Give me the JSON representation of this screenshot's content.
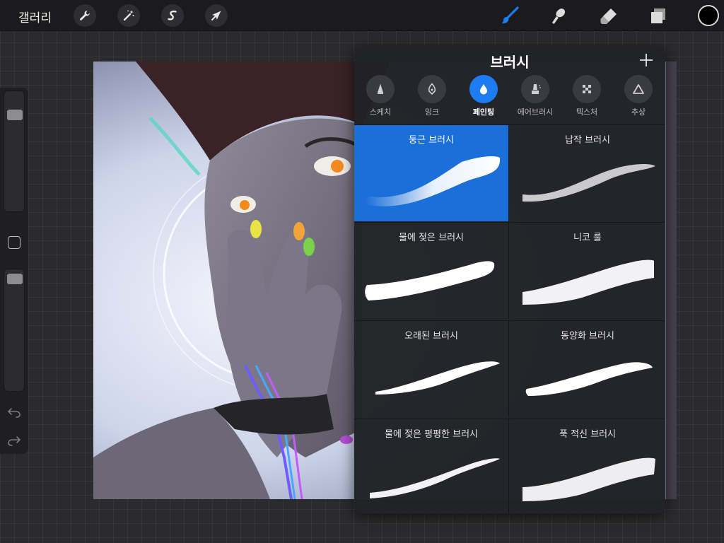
{
  "topbar": {
    "gallery_label": "갤러리",
    "actions_icon": "wrench-icon",
    "adjustments_icon": "magic-wand-icon",
    "selection_icon": "selection-s-icon",
    "transform_icon": "arrow-cursor-icon",
    "paint_icon": "brush-icon",
    "smudge_icon": "smudge-finger-icon",
    "erase_icon": "eraser-icon",
    "layers_icon": "layers-icon",
    "current_color": "#000000",
    "accent_color": "#1d7cf2"
  },
  "sidebar": {
    "brush_size_level": 0.05,
    "opacity_level": 0.05,
    "modify_icon": "square-icon",
    "undo_icon": "undo-icon",
    "redo_icon": "redo-icon"
  },
  "panel": {
    "title": "브러시",
    "add_icon": "plus-icon",
    "categories": [
      {
        "label": "스케치",
        "icon": "pencil-icon",
        "active": false
      },
      {
        "label": "잉크",
        "icon": "pen-nib-icon",
        "active": false
      },
      {
        "label": "페인팅",
        "icon": "droplet-icon",
        "active": true
      },
      {
        "label": "에어브러시",
        "icon": "airbrush-icon",
        "active": false
      },
      {
        "label": "텍스처",
        "icon": "texture-icon",
        "active": false
      },
      {
        "label": "추상",
        "icon": "triangle-icon",
        "active": false
      }
    ],
    "brushes": [
      {
        "name": "둥근 브러시",
        "selected": true
      },
      {
        "name": "납작 브러시",
        "selected": false
      },
      {
        "name": "물에 젖은 브러시",
        "selected": false
      },
      {
        "name": "니코 룰",
        "selected": false
      },
      {
        "name": "오래된 브러시",
        "selected": false
      },
      {
        "name": "동양화 브러시",
        "selected": false
      },
      {
        "name": "물에 젖은 평평한 브러시",
        "selected": false
      },
      {
        "name": "푹 적신 브러시",
        "selected": false
      }
    ]
  }
}
